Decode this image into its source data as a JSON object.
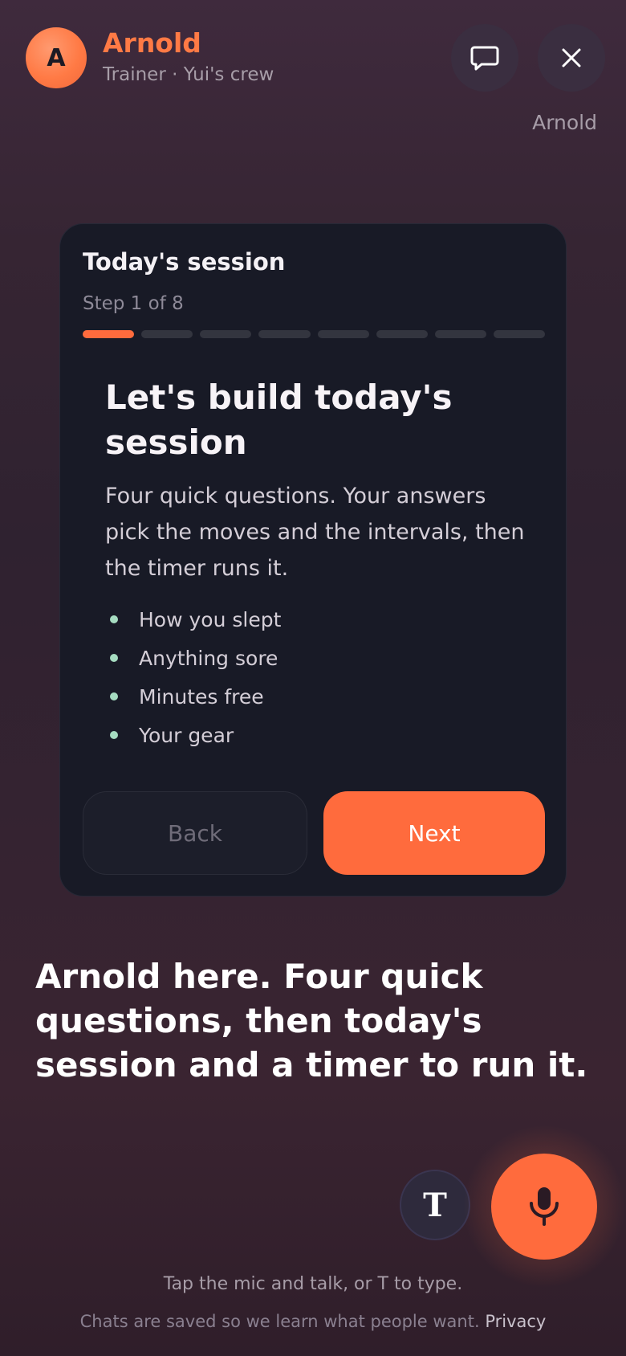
{
  "header": {
    "avatar_initial": "A",
    "trainer_name": "Arnold",
    "trainer_subtitle": "Trainer · Yui's crew",
    "chat_icon": "chat-bubble-icon",
    "close_icon": "close-icon",
    "close_caption": "Arnold"
  },
  "card": {
    "title": "Today's session",
    "step_text": "Step 1 of 8",
    "progress": {
      "current": 1,
      "total": 8
    },
    "headline": "Let's build today's session",
    "description": "Four quick questions. Your answers pick the moves and the intervals, then the timer runs it.",
    "bullets": [
      "How you slept",
      "Anything sore",
      "Minutes free",
      "Your gear"
    ],
    "back_label": "Back",
    "next_label": "Next"
  },
  "speech": "Arnold here. Four quick questions, then today's session and a timer to run it.",
  "controls": {
    "type_label": "T",
    "mic_icon": "microphone-icon"
  },
  "footer": {
    "hint": "Tap the mic and talk, or T to type.",
    "notice": "Chats are saved so we learn what people want.",
    "privacy_link": "Privacy"
  },
  "colors": {
    "accent": "#ff6b3d",
    "card_bg": "#181a26",
    "bullet_dot": "#a6dcc1"
  }
}
